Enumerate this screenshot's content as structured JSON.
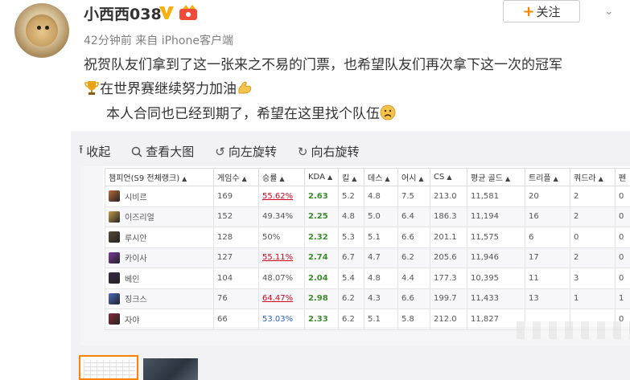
{
  "post": {
    "username": "小西西038",
    "meta": "42分钟前 来自 iPhone客户端",
    "follow_label": "关注",
    "follow_plus": "+",
    "line1": "祝贺队友们拿到了这一张来之不易的门票，也希望队友们再次拿下这一次的冠军",
    "line2": "在世界赛继续努力加油",
    "line3": "本人合同也已经到期了，希望在这里找个队伍",
    "icons": [
      "verified-icon",
      "vip-icon",
      "trophy-icon",
      "flexed-biceps-icon",
      "sad-face-icon",
      "chevron-down-icon"
    ]
  },
  "toolbar": {
    "collapse": "收起",
    "view_large": "查看大图",
    "rotate_left": "向左旋转",
    "rotate_right": "向右旋转"
  },
  "table": {
    "headers": [
      "챔피언(S9 전체랭크)",
      "게임수",
      "승률",
      "KDA",
      "킬",
      "데스",
      "어시",
      "CS",
      "평균 골드",
      "트리플",
      "쿼드라",
      "펜"
    ],
    "rows": [
      {
        "champ": "시비르",
        "games": "169",
        "wr": "55.62%",
        "kda": "2.63",
        "k": "5.2",
        "d": "4.8",
        "a": "7.5",
        "cs": "213.0",
        "gold": "11,581",
        "triple": "20",
        "quadra": "2",
        "penta": "0",
        "wr_style": "red",
        "color": "#b86b3a"
      },
      {
        "champ": "이즈리얼",
        "games": "152",
        "wr": "49.34%",
        "kda": "2.25",
        "k": "4.8",
        "d": "5.0",
        "a": "6.4",
        "cs": "186.3",
        "gold": "11,194",
        "triple": "16",
        "quadra": "2",
        "penta": "0",
        "wr_style": "plain",
        "color": "#c79a4a"
      },
      {
        "champ": "루시안",
        "games": "128",
        "wr": "50%",
        "kda": "2.32",
        "k": "5.3",
        "d": "5.1",
        "a": "6.6",
        "cs": "201.1",
        "gold": "11,575",
        "triple": "6",
        "quadra": "0",
        "penta": "0",
        "wr_style": "plain",
        "color": "#5a4a3a"
      },
      {
        "champ": "카이사",
        "games": "127",
        "wr": "55.11%",
        "kda": "2.74",
        "k": "6.7",
        "d": "4.7",
        "a": "6.2",
        "cs": "205.6",
        "gold": "11,946",
        "triple": "17",
        "quadra": "2",
        "penta": "0",
        "wr_style": "red",
        "color": "#7a3aa0"
      },
      {
        "champ": "베인",
        "games": "104",
        "wr": "48.07%",
        "kda": "2.04",
        "k": "5.4",
        "d": "4.8",
        "a": "4.4",
        "cs": "177.3",
        "gold": "10,395",
        "triple": "11",
        "quadra": "3",
        "penta": "0",
        "wr_style": "plain",
        "color": "#3a2a4a"
      },
      {
        "champ": "징크스",
        "games": "76",
        "wr": "64.47%",
        "kda": "2.98",
        "k": "6.2",
        "d": "4.3",
        "a": "6.6",
        "cs": "199.7",
        "gold": "11,433",
        "triple": "13",
        "quadra": "1",
        "penta": "1",
        "wr_style": "red",
        "color": "#4a6ac0"
      },
      {
        "champ": "자야",
        "games": "66",
        "wr": "53.03%",
        "kda": "2.33",
        "k": "6.2",
        "d": "5.1",
        "a": "5.8",
        "cs": "212.0",
        "gold": "11,827",
        "triple": "",
        "quadra": "",
        "penta": "0",
        "wr_style": "blue",
        "color": "#8a2a3a"
      }
    ]
  }
}
